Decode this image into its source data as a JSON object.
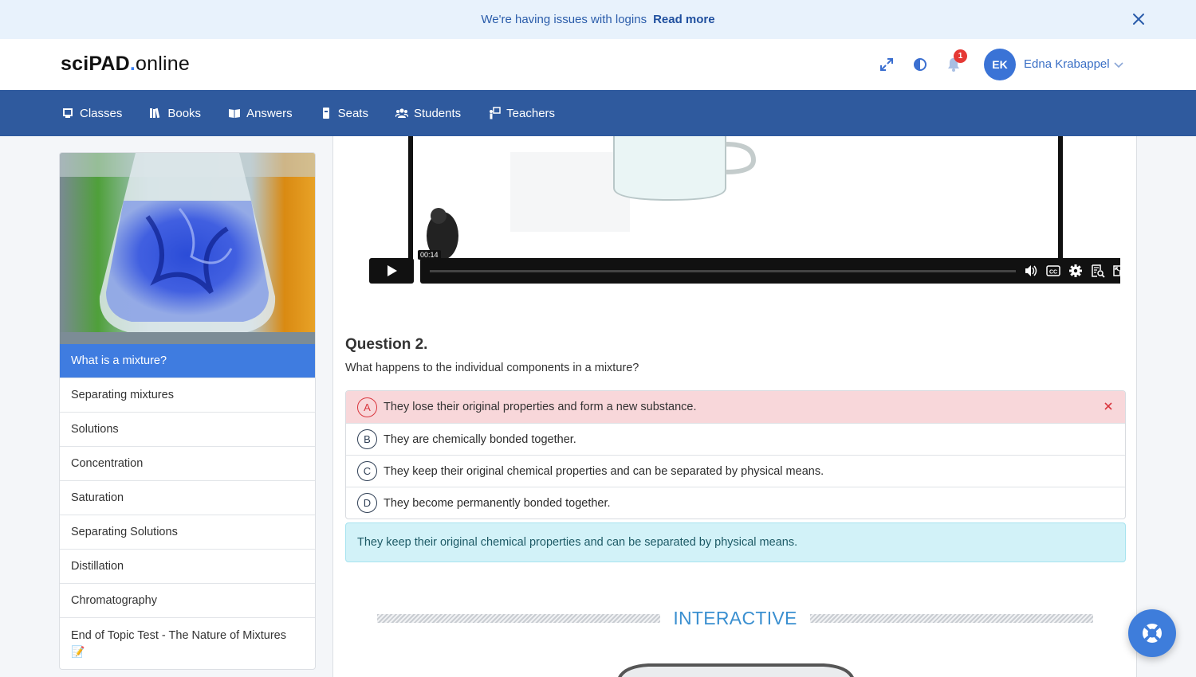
{
  "alert": {
    "message": "We're having issues with logins",
    "link_label": "Read more"
  },
  "header": {
    "logo_part1": "sciPAD",
    "logo_dot": ".",
    "logo_part2": "online",
    "notification_count": "1",
    "user_initials": "EK",
    "user_name": "Edna Krabappel"
  },
  "nav": {
    "items": [
      {
        "label": "Classes",
        "icon": "class-icon"
      },
      {
        "label": "Books",
        "icon": "books-icon"
      },
      {
        "label": "Answers",
        "icon": "open-book-icon"
      },
      {
        "label": "Seats",
        "icon": "seat-icon"
      },
      {
        "label": "Students",
        "icon": "students-icon"
      },
      {
        "label": "Teachers",
        "icon": "teacher-icon"
      }
    ]
  },
  "sidebar": {
    "items": [
      {
        "label": "What is a mixture?",
        "active": true
      },
      {
        "label": "Separating mixtures"
      },
      {
        "label": "Solutions"
      },
      {
        "label": "Concentration"
      },
      {
        "label": "Saturation"
      },
      {
        "label": "Separating Solutions"
      },
      {
        "label": "Distillation"
      },
      {
        "label": "Chromatography"
      },
      {
        "label": "End of Topic Test - The Nature of Mixtures",
        "icon": "pencil-memo-icon"
      }
    ]
  },
  "video": {
    "current_time": "00:14"
  },
  "question": {
    "title": "Question 2.",
    "text": "What happens to the individual components in a mixture?",
    "options": [
      {
        "letter": "A",
        "text": "They lose their original properties and form a new substance.",
        "state": "incorrect"
      },
      {
        "letter": "B",
        "text": "They are chemically bonded together."
      },
      {
        "letter": "C",
        "text": "They keep their original chemical properties and can be separated by physical means."
      },
      {
        "letter": "D",
        "text": "They become permanently bonded together."
      }
    ],
    "answer": "They keep their original chemical properties and can be separated by physical means."
  },
  "interactive": {
    "label": "INTERACTIVE"
  },
  "colors": {
    "nav_bg": "#2f5a9e",
    "accent": "#3f7ce0",
    "wrong_bg": "#f8d7da",
    "answer_bg": "#d2f2f8"
  }
}
